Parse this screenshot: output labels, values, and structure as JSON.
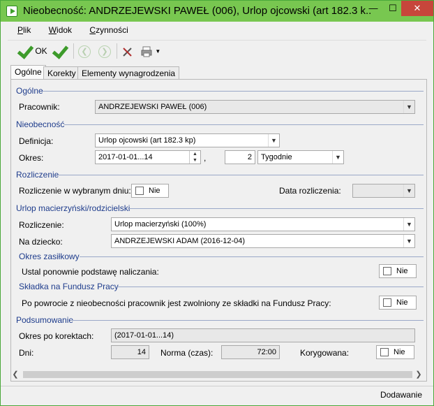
{
  "window": {
    "title": "Nieobecność: ANDRZEJEWSKI PAWEŁ (006), Urlop ojcowski (art 182.3 k...",
    "minimize": "—",
    "maximize": "☐",
    "close": "✕"
  },
  "menu": [
    {
      "key": "P",
      "rest": "lik"
    },
    {
      "key": "W",
      "rest": "idok"
    },
    {
      "key": "C",
      "rest": "zynności"
    }
  ],
  "toolbar": {
    "ok_label": "OK",
    "back": "❮",
    "forward": "❯",
    "print_dropdown": "▼"
  },
  "tabs": [
    "Ogólne",
    "Korekty",
    "Elementy wynagrodzenia"
  ],
  "sections": {
    "ogolne": "Ogólne",
    "nieobecnosc": "Nieobecność",
    "rozliczenie": "Rozliczenie",
    "urlop": "Urlop macierzyński/rodzicielski",
    "okres_zasilkowy": "Okres zasiłkowy",
    "skladka": "Składka na Fundusz Pracy",
    "podsumowanie": "Podsumowanie"
  },
  "fields": {
    "pracownik_label": "Pracownik:",
    "pracownik_value": "ANDRZEJEWSKI PAWEŁ (006)",
    "definicja_label": "Definicja:",
    "definicja_value": "Urlop ojcowski (art 182.3 kp)",
    "okres_label": "Okres:",
    "okres_value": "2017-01-01...14",
    "okres_sep": ",",
    "okres_count": "2",
    "okres_unit": "Tygodnie",
    "rozl_dniu_label": "Rozliczenie w wybranym dniu:",
    "rozl_dniu_value": "Nie",
    "data_rozl_label": "Data rozliczenia:",
    "urlop_rozl_label": "Rozliczenie:",
    "urlop_rozl_value": "Urlop macierzyński (100%)",
    "na_dziecko_label": "Na dziecko:",
    "na_dziecko_value": "ANDRZEJEWSKI ADAM (2016-12-04)",
    "ustal_label": "Ustal ponownie podstawę naliczania:",
    "ustal_value": "Nie",
    "po_powrocie_label": "Po powrocie z nieobecności pracownik jest zwolniony ze składki na Fundusz Pracy:",
    "po_powrocie_value": "Nie",
    "okres_po_korektach_label": "Okres po korektach:",
    "okres_po_korektach_value": "(2017-01-01...14)",
    "dni_label": "Dni:",
    "dni_value": "14",
    "norma_label": "Norma (czas):",
    "norma_value": "72:00",
    "korygowana_label": "Korygowana:",
    "korygowana_value": "Nie"
  },
  "scroll": {
    "left": "❮",
    "right": "❯"
  },
  "status": "Dodawanie"
}
